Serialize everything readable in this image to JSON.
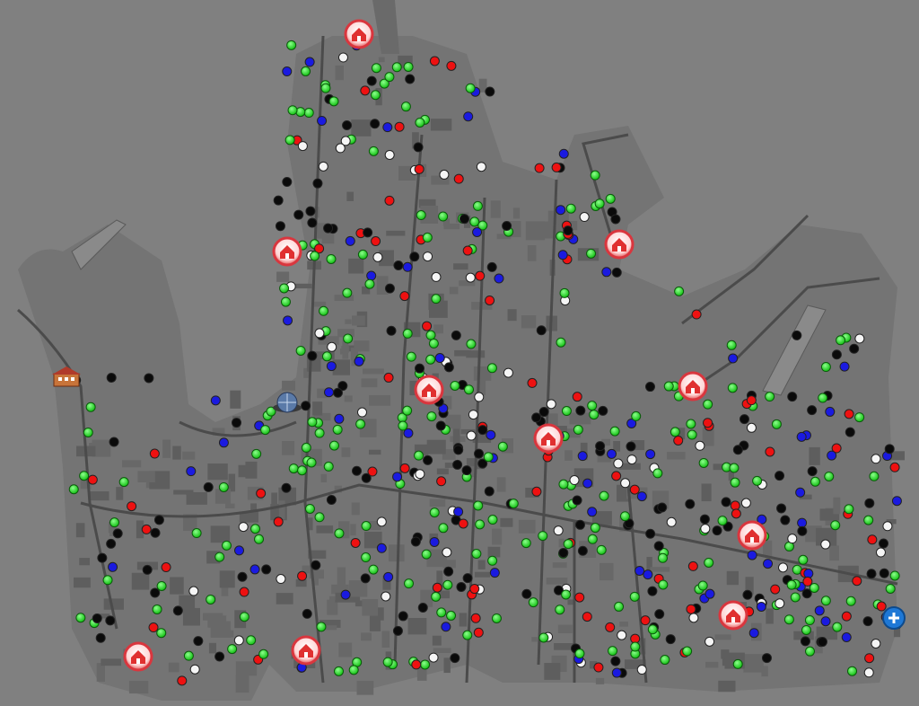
{
  "colors": {
    "background": "#808080",
    "land": "#747474",
    "block": "#5c5c5c",
    "road": "#4b4b4b",
    "dot_green": "#22e622",
    "dot_black": "#0a0a0a",
    "dot_red": "#ee1111",
    "dot_blue": "#1a1ae0",
    "dot_white": "#f5f5f5",
    "marker_ring": "#e0303a",
    "zoom_button": "#1e78d6"
  },
  "icons": {
    "house_marker": "house-marker-icon",
    "school": "school-building-icon",
    "globe": "globe-landmark-icon",
    "zoom_in": "zoom-in-plus-icon"
  },
  "legend_note": ""
}
